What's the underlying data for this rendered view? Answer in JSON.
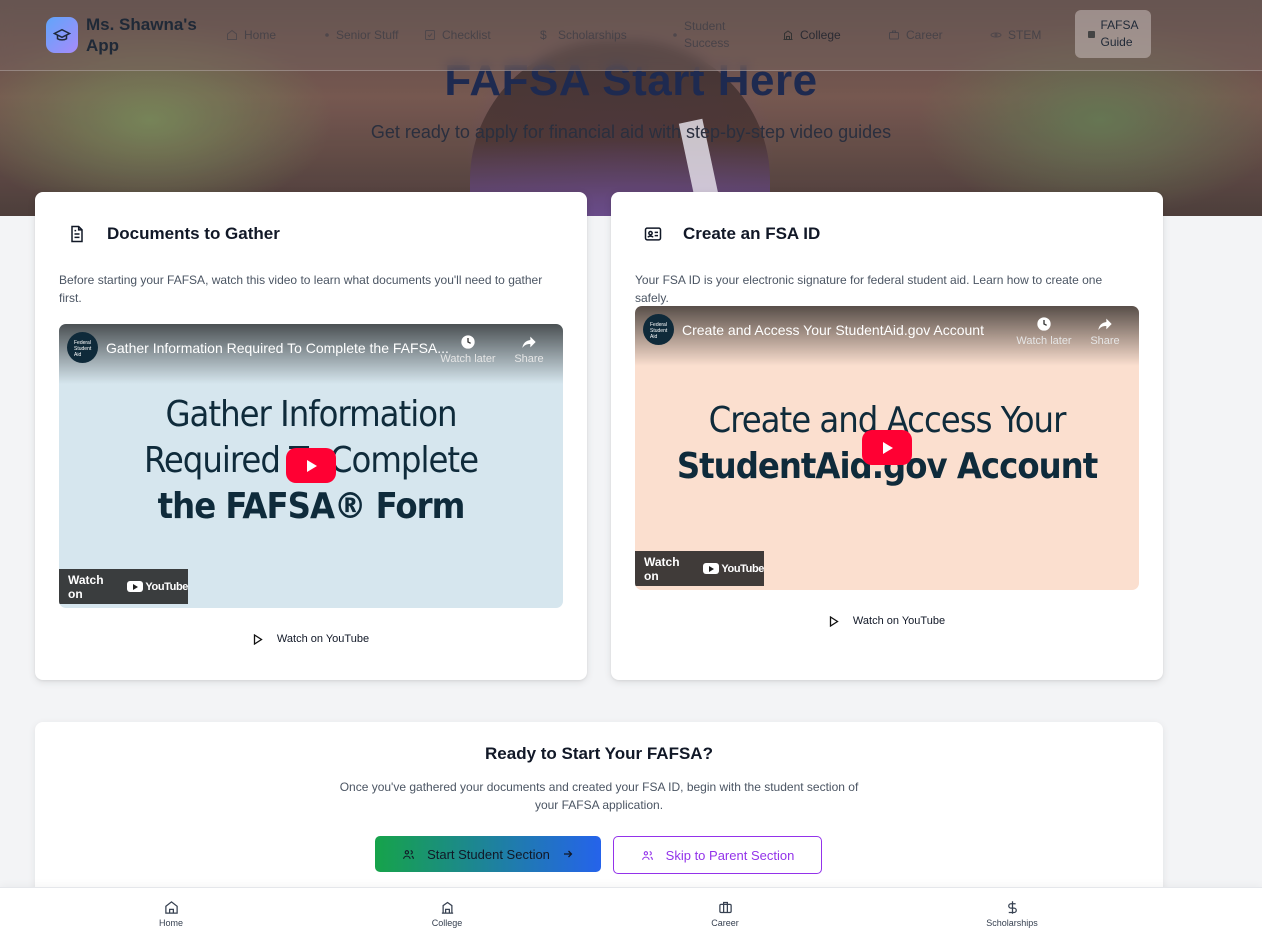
{
  "app": {
    "name": "Ms. Shawna's App"
  },
  "topnav": {
    "items": [
      {
        "label": "Home"
      },
      {
        "label": "Senior Stuff"
      },
      {
        "label": "Checklist"
      },
      {
        "label": "Scholarships"
      },
      {
        "label": "Student Success"
      },
      {
        "label": "College"
      },
      {
        "label": "Career"
      },
      {
        "label": "STEM"
      }
    ],
    "active": {
      "label": "FAFSA Guide"
    }
  },
  "hero": {
    "title": "FAFSA Start Here",
    "subtitle": "Get ready to apply for financial aid with step-by-step video guides"
  },
  "cards": [
    {
      "title": "Documents to Gather",
      "description": "Before starting your FAFSA, watch this video to learn what documents you'll need to gather first.",
      "video": {
        "channel": "Federal Student Aid",
        "title": "Gather Information Required To Complete the FAFSA...",
        "thumb_lines": [
          "Gather Information",
          "Required To Complete",
          "the FAFSA® Form"
        ],
        "watch_later": "Watch later",
        "share": "Share",
        "watch_on": "Watch on",
        "youtube": "YouTube"
      },
      "watch_link": "Watch on YouTube"
    },
    {
      "title": "Create an FSA ID",
      "description": "Your FSA ID is your electronic signature for federal student aid. Learn how to create one safely.",
      "video": {
        "channel": "Federal Student Aid",
        "title": "Create and Access Your StudentAid.gov Account",
        "thumb_lines": [
          "Create and Access Your",
          "StudentAid.gov Account"
        ],
        "watch_later": "Watch later",
        "share": "Share",
        "watch_on": "Watch on",
        "youtube": "YouTube"
      },
      "watch_link": "Watch on YouTube"
    }
  ],
  "ready": {
    "title": "Ready to Start Your FAFSA?",
    "description": "Once you've gathered your documents and created your FSA ID, begin with the student section of your FAFSA application.",
    "start_button": "Start Student Section",
    "skip_button": "Skip to Parent Section"
  },
  "bottomnav": {
    "items": [
      {
        "label": "Home"
      },
      {
        "label": "College"
      },
      {
        "label": "Career"
      },
      {
        "label": "Scholarships"
      }
    ]
  },
  "colors": {
    "primary_gradient_start": "#16a34a",
    "primary_gradient_end": "#2563eb",
    "secondary_accent": "#9333ea",
    "youtube_red": "#ff0033"
  }
}
